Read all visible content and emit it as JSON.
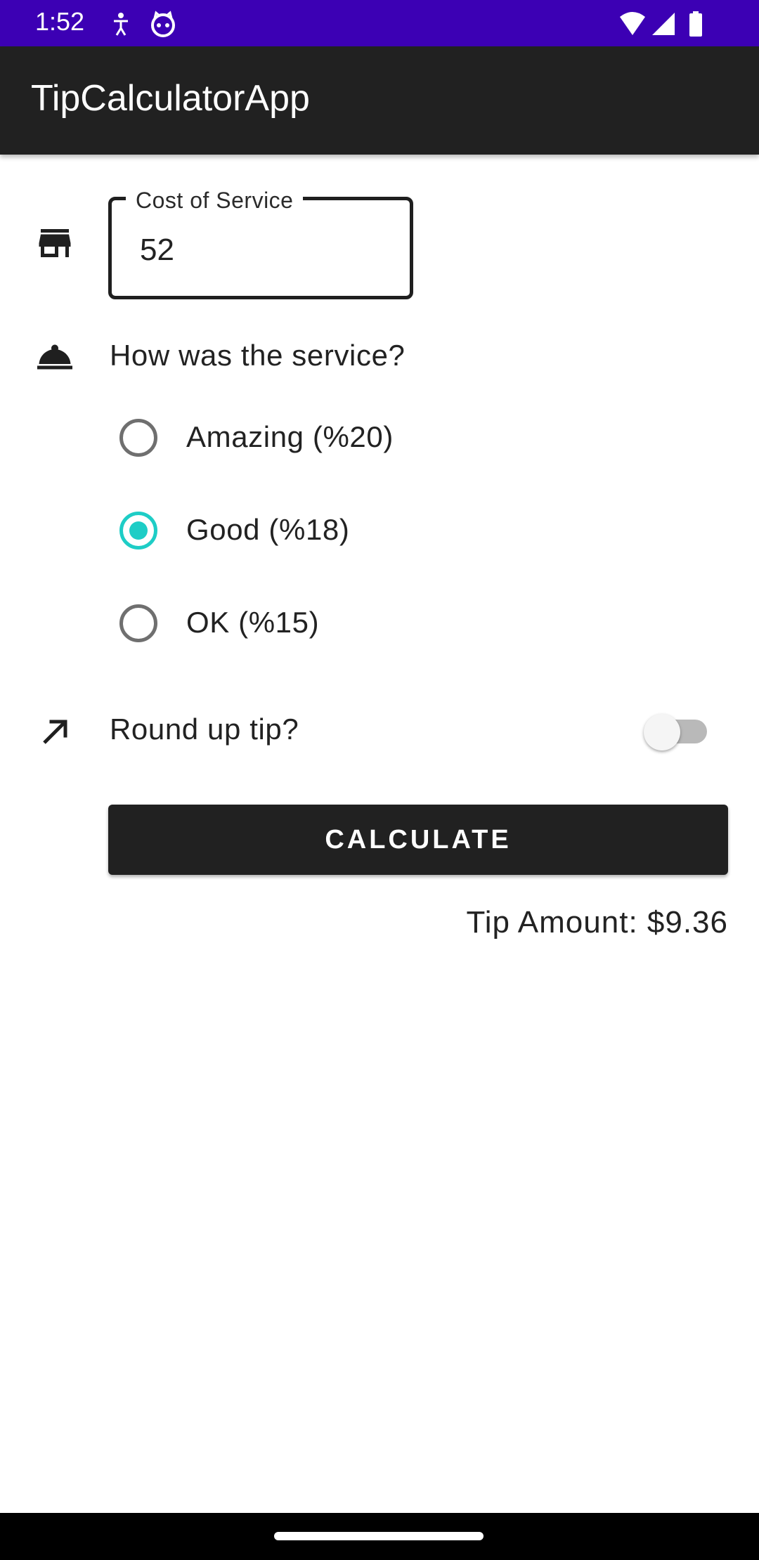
{
  "status_bar": {
    "time": "1:52",
    "left_icons": [
      "accessibility-icon",
      "android-cat-icon"
    ],
    "right_icons": [
      "wifi-icon",
      "cell-signal-icon",
      "battery-icon"
    ],
    "color": "#3c00b4"
  },
  "app_bar": {
    "title": "TipCalculatorApp",
    "color": "#212121"
  },
  "cost_field": {
    "label": "Cost of Service",
    "value": "52",
    "icon": "store-icon"
  },
  "service": {
    "question": "How was the service?",
    "icon": "room-service-icon",
    "options": [
      {
        "label": "Amazing (%20)",
        "selected": false
      },
      {
        "label": "Good (%18)",
        "selected": true
      },
      {
        "label": "OK (%15)",
        "selected": false
      }
    ],
    "accent": "#1ecdc6"
  },
  "round_up": {
    "label": "Round up tip?",
    "icon": "trending-up-arrow-icon",
    "enabled": false
  },
  "calculate_button": {
    "label": "CALCULATE"
  },
  "result": {
    "text": "Tip Amount: $9.36"
  }
}
